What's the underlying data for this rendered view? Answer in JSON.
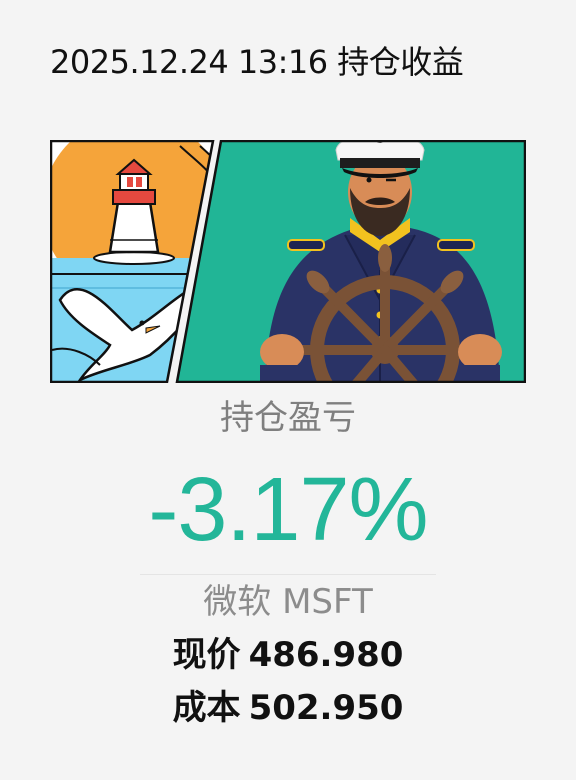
{
  "header": {
    "title": "2025.12.24 13:16 持仓收益"
  },
  "summary": {
    "section_label": "持仓盈亏",
    "pnl_percent": "-3.17%",
    "stock_name": "微软 MSFT",
    "current_price_label": "现价",
    "current_price": "486.980",
    "cost_price_label": "成本",
    "cost_price": "502.950"
  },
  "colors": {
    "pnl_negative": "#23b699",
    "banner_bg": "#21b596",
    "sun": "#f5a43a",
    "sky": "#7fd6f3"
  },
  "icons": {
    "left_panel": "lighthouse-seagull-illustration",
    "right_panel": "captain-at-ship-wheel-illustration"
  }
}
